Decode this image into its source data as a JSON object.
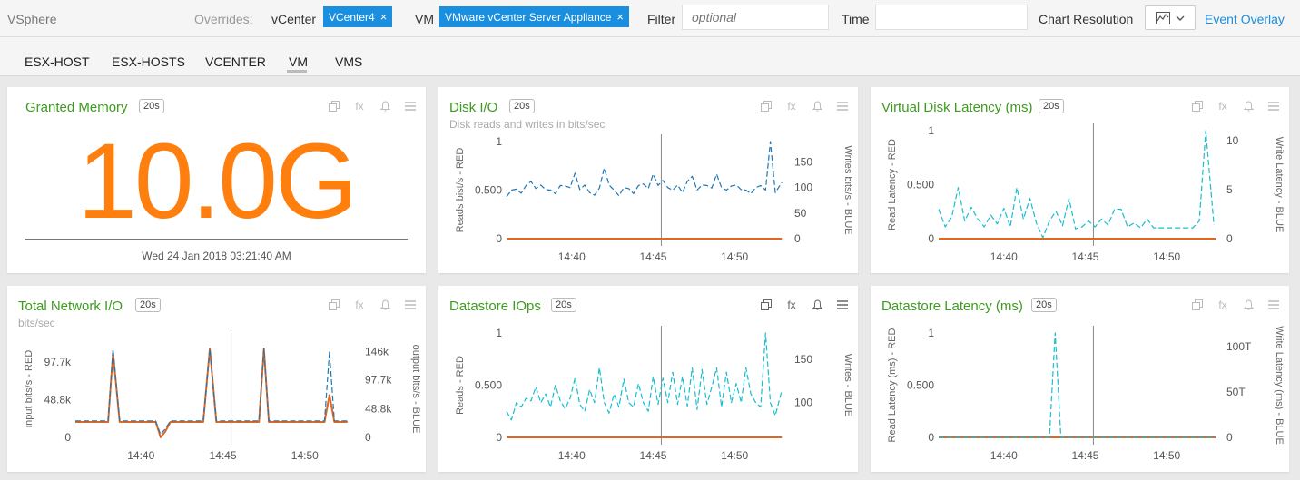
{
  "header": {
    "app_title": "VSphere",
    "overrides_label": "Overrides:",
    "vcenter_label": "vCenter",
    "vcenter_chip": "VCenter4",
    "vm_label": "VM",
    "vm_chip": "VMware vCenter Server Appliance",
    "chip_close": "×",
    "filter_label": "Filter",
    "filter_placeholder": "optional",
    "time_label": "Time",
    "time_value": "",
    "resolution_label": "Chart Resolution",
    "event_overlay": "Event Overlay"
  },
  "tabs": [
    {
      "label": "ESX-HOST"
    },
    {
      "label": "ESX-HOSTS"
    },
    {
      "label": "VCENTER"
    },
    {
      "label": "VM",
      "active": true
    },
    {
      "label": "VMS"
    }
  ],
  "panels": [
    {
      "title": "Granted Memory",
      "badge": "20s",
      "big_value": "10.0G",
      "timestamp": "Wed 24 Jan 2018 03:21:40 AM"
    },
    {
      "title": "Disk I/O",
      "badge": "20s",
      "subtitle": "Disk reads and writes in bits/sec"
    },
    {
      "title": "Virtual Disk Latency (ms)",
      "badge": "20s"
    },
    {
      "title": "Total Network I/O",
      "badge": "20s",
      "subtitle": "bits/sec"
    },
    {
      "title": "Datastore IOps",
      "badge": "20s"
    },
    {
      "title": "Datastore Latency (ms)",
      "badge": "20s"
    }
  ],
  "tools": {
    "copy": "copy-icon",
    "fx": "fx",
    "bell": "bell-icon",
    "menu": "menu-icon"
  },
  "colors": {
    "accent": "#1a8fe0",
    "title_green": "#3d9b1e",
    "big_orange": "#ff7f0e",
    "series_red": "#e2661e",
    "series_blue": "#1f77b4",
    "series_cyan": "#17becf"
  },
  "chart_data": [
    {
      "type": "line",
      "title": "Disk I/O",
      "ylabel_left": "Reads bist/s - RED",
      "ylabel_right": "Writes bits/s - BLUE",
      "left_ticks": [
        "0",
        "0.500",
        "1"
      ],
      "left_range": [
        0,
        1
      ],
      "right_ticks": [
        "0",
        "50",
        "100",
        "150"
      ],
      "right_range": [
        0,
        190
      ],
      "x_ticks": [
        "14:40",
        "14:45",
        "14:50"
      ],
      "x_range": [
        36.0,
        53.0
      ],
      "x_tick_values": [
        40,
        45,
        50
      ],
      "marker_x": 45.5,
      "series": [
        {
          "color": "#e2661e",
          "dash": false,
          "axis": "left",
          "x": [
            36.0,
            52.9
          ],
          "y": [
            0,
            0
          ]
        },
        {
          "color": "#1f77b4",
          "dash": true,
          "axis": "right",
          "x": [
            36.0,
            36.3,
            36.6,
            36.9,
            37.2,
            37.5,
            37.8,
            38.1,
            38.4,
            38.7,
            39.0,
            39.3,
            39.6,
            39.9,
            40.2,
            40.5,
            40.8,
            41.1,
            41.4,
            41.7,
            42.0,
            42.3,
            42.6,
            42.9,
            43.2,
            43.5,
            43.8,
            44.1,
            44.4,
            44.7,
            45.0,
            45.3,
            45.6,
            45.9,
            46.2,
            46.5,
            46.8,
            47.1,
            47.4,
            47.7,
            48.0,
            48.3,
            48.6,
            48.9,
            49.2,
            49.5,
            49.8,
            50.1,
            50.4,
            50.7,
            51.0,
            51.3,
            51.6,
            51.9,
            52.2,
            52.5,
            52.9
          ],
          "y": [
            82,
            95,
            97,
            89,
            104,
            112,
            98,
            105,
            96,
            95,
            88,
            104,
            103,
            100,
            128,
            96,
            105,
            90,
            85,
            99,
            138,
            105,
            95,
            84,
            100,
            98,
            88,
            104,
            107,
            98,
            126,
            104,
            114,
            100,
            95,
            105,
            90,
            112,
            122,
            95,
            105,
            104,
            99,
            126,
            100,
            95,
            103,
            105,
            96,
            95,
            88,
            100,
            104,
            95,
            190,
            90,
            110
          ]
        }
      ]
    },
    {
      "type": "line",
      "title": "Virtual Disk Latency (ms)",
      "ylabel_left": "Read Latency - RED",
      "ylabel_right": "Write Latency - BLUE",
      "left_ticks": [
        "0",
        "0.500",
        "1"
      ],
      "left_range": [
        0,
        1
      ],
      "right_ticks": [
        "0",
        "5",
        "10"
      ],
      "right_range": [
        0,
        11
      ],
      "x_ticks": [
        "14:40",
        "14:45",
        "14:50"
      ],
      "x_range": [
        36.0,
        53.0
      ],
      "x_tick_values": [
        40,
        45,
        50
      ],
      "marker_x": 45.5,
      "series": [
        {
          "color": "#e2661e",
          "dash": false,
          "axis": "left",
          "x": [
            36.0,
            53.0
          ],
          "y": [
            0,
            0
          ]
        },
        {
          "color": "#17becf",
          "dash": true,
          "axis": "right",
          "x": [
            36.0,
            36.4,
            36.8,
            37.2,
            37.6,
            38.0,
            38.4,
            38.8,
            39.2,
            39.6,
            40.0,
            40.4,
            40.8,
            41.2,
            41.6,
            42.0,
            42.4,
            42.8,
            43.2,
            43.6,
            44.0,
            44.4,
            44.8,
            45.2,
            45.6,
            46.0,
            46.4,
            46.8,
            47.2,
            47.6,
            48.0,
            48.4,
            48.8,
            49.2,
            49.6,
            50.0,
            50.4,
            50.8,
            51.2,
            51.6,
            52.0,
            52.4,
            52.9
          ],
          "y": [
            3,
            1.2,
            2.2,
            5.2,
            1.8,
            3.2,
            2,
            1.2,
            2.4,
            1.5,
            3.1,
            1.2,
            5.2,
            2,
            4.1,
            1.6,
            0.1,
            1.8,
            2.8,
            1.3,
            4.1,
            1,
            1.2,
            1.8,
            1.2,
            2,
            1.4,
            3,
            3,
            1.2,
            1.6,
            1.1,
            2,
            1.1,
            1.1,
            1.1,
            1.1,
            1.1,
            1.1,
            1.1,
            1.8,
            11,
            1.4
          ]
        }
      ]
    },
    {
      "type": "line",
      "title": "Total Network I/O",
      "ylabel_left": "input bits/s - RED",
      "ylabel_right": "output bits/s - BLUE",
      "left_ticks": [
        "0",
        "48.8k",
        "97.7k"
      ],
      "left_range": [
        0,
        126000
      ],
      "right_ticks": [
        "0",
        "48.8k",
        "97.7k",
        "146k"
      ],
      "right_range": [
        0,
        165000
      ],
      "x_ticks": [
        "14:40",
        "14:45",
        "14:50"
      ],
      "x_range": [
        36.0,
        53.0
      ],
      "x_tick_values": [
        40,
        45,
        50
      ],
      "marker_x": 45.5,
      "series": [
        {
          "color": "#e2661e",
          "dash": false,
          "axis": "left",
          "x": [
            36.0,
            37.6,
            38.0,
            38.3,
            38.7,
            40.9,
            41.2,
            41.5,
            41.8,
            43.4,
            43.8,
            44.2,
            44.6,
            46.9,
            47.2,
            47.5,
            47.8,
            49.3,
            49.6,
            50.0,
            50.4,
            51.2,
            51.5,
            51.8,
            52.2,
            52.6
          ],
          "y": [
            20000,
            20000,
            20000,
            110000,
            20000,
            20000,
            0,
            8000,
            20000,
            20000,
            20000,
            115000,
            20000,
            20000,
            20000,
            115000,
            20000,
            20000,
            20000,
            20000,
            20000,
            20000,
            55000,
            20000,
            20000,
            20000
          ]
        },
        {
          "color": "#1f77b4",
          "dash": true,
          "axis": "right",
          "x": [
            36.0,
            37.6,
            38.0,
            38.3,
            38.7,
            40.9,
            41.2,
            41.5,
            41.8,
            43.4,
            43.8,
            44.2,
            44.6,
            46.9,
            47.2,
            47.5,
            47.8,
            49.3,
            49.6,
            50.0,
            50.4,
            51.2,
            51.5,
            51.8,
            52.2,
            52.6
          ],
          "y": [
            28000,
            28000,
            28000,
            150000,
            28000,
            28000,
            5000,
            15000,
            28000,
            28000,
            28000,
            150000,
            28000,
            28000,
            28000,
            150000,
            28000,
            28000,
            28000,
            28000,
            28000,
            28000,
            145000,
            28000,
            28000,
            28000
          ]
        }
      ]
    },
    {
      "type": "line",
      "title": "Datastore IOps",
      "ylabel_left": "Reads - RED",
      "ylabel_right": "Writes - BLUE",
      "left_ticks": [
        "0",
        "0.500",
        "1"
      ],
      "left_range": [
        0,
        1
      ],
      "right_ticks": [
        "100",
        "150"
      ],
      "right_range": [
        60,
        180
      ],
      "x_ticks": [
        "14:40",
        "14:45",
        "14:50"
      ],
      "x_range": [
        36.0,
        53.0
      ],
      "x_tick_values": [
        40,
        45,
        50
      ],
      "marker_x": 45.5,
      "series": [
        {
          "color": "#e2661e",
          "dash": false,
          "axis": "left",
          "x": [
            36.0,
            52.9
          ],
          "y": [
            0,
            0
          ]
        },
        {
          "color": "#17becf",
          "dash": true,
          "axis": "right",
          "x": [
            36.0,
            36.3,
            36.6,
            36.9,
            37.2,
            37.5,
            37.8,
            38.1,
            38.4,
            38.7,
            39.0,
            39.3,
            39.6,
            39.9,
            40.2,
            40.5,
            40.8,
            41.1,
            41.4,
            41.7,
            42.0,
            42.3,
            42.6,
            42.9,
            43.2,
            43.5,
            43.8,
            44.1,
            44.4,
            44.7,
            45.0,
            45.3,
            45.6,
            45.9,
            46.2,
            46.5,
            46.8,
            47.1,
            47.4,
            47.7,
            48.0,
            48.3,
            48.6,
            48.9,
            49.2,
            49.5,
            49.8,
            50.1,
            50.4,
            50.7,
            51.0,
            51.3,
            51.6,
            51.9,
            52.2,
            52.5,
            52.9
          ],
          "y": [
            90,
            80,
            100,
            95,
            105,
            102,
            118,
            100,
            110,
            95,
            120,
            102,
            93,
            105,
            128,
            98,
            90,
            115,
            100,
            140,
            100,
            88,
            110,
            95,
            127,
            100,
            95,
            122,
            100,
            90,
            130,
            98,
            128,
            100,
            135,
            98,
            130,
            96,
            140,
            92,
            138,
            98,
            118,
            140,
            95,
            135,
            100,
            122,
            100,
            140,
            110,
            100,
            95,
            180,
            100,
            85,
            114
          ]
        }
      ]
    },
    {
      "type": "line",
      "title": "Datastore Latency (ms)",
      "ylabel_left": "Read Latency (ms) - RED",
      "ylabel_right": "Write Latency (ms) - BLUE",
      "left_ticks": [
        "0",
        "0.500",
        "1"
      ],
      "left_range": [
        0,
        1
      ],
      "right_ticks": [
        "0",
        "50T",
        "100T"
      ],
      "right_range": [
        0,
        115
      ],
      "x_ticks": [
        "14:40",
        "14:45",
        "14:50"
      ],
      "x_range": [
        36.0,
        53.0
      ],
      "x_tick_values": [
        40,
        45,
        50
      ],
      "marker_x": 45.5,
      "series": [
        {
          "color": "#e2661e",
          "dash": false,
          "axis": "left",
          "x": [
            36.0,
            53.0
          ],
          "y": [
            0,
            0
          ]
        },
        {
          "color": "#17becf",
          "dash": true,
          "axis": "right",
          "x": [
            36.0,
            42.8,
            43.15,
            43.5,
            53.0
          ],
          "y": [
            0,
            0,
            115,
            0,
            0
          ]
        }
      ]
    }
  ]
}
